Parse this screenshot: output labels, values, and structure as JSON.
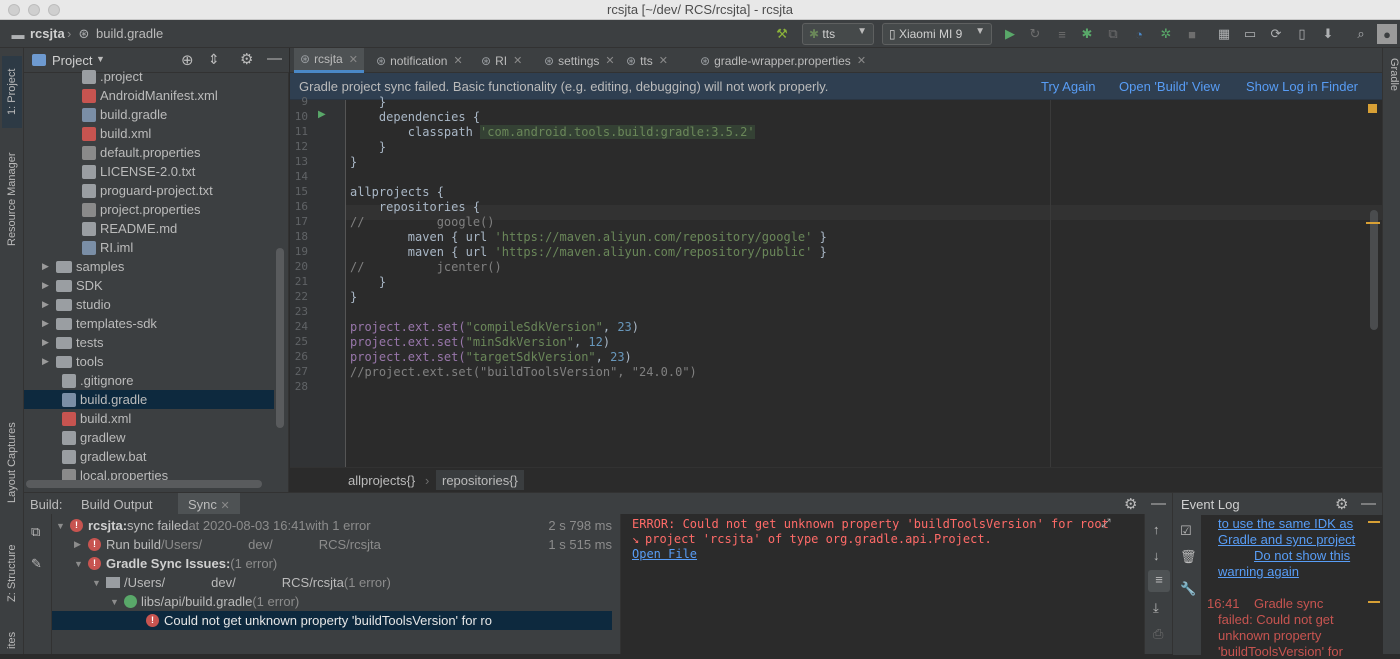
{
  "window": {
    "title": "rcsjta [~/dev/           RCS/rcsjta] - rcsjta"
  },
  "navbar": {
    "project": "rcsjta",
    "file": "build.gradle",
    "run_config": "tts",
    "device": "Xiaomi MI 9"
  },
  "left_strip": {
    "project_tab": "1: Project",
    "resource_manager": "Resource Manager",
    "layout_captures": "Layout Captures",
    "structure": "Z: Structure",
    "favorites": "ites"
  },
  "right_strip": {
    "gradle": "Gradle"
  },
  "project_panel": {
    "title": "Project",
    "items": [
      {
        "label": ".project",
        "kind": "file"
      },
      {
        "label": "AndroidManifest.xml",
        "kind": "xml"
      },
      {
        "label": "build.gradle",
        "kind": "gradle"
      },
      {
        "label": "build.xml",
        "kind": "xml"
      },
      {
        "label": "default.properties",
        "kind": "props"
      },
      {
        "label": "LICENSE-2.0.txt",
        "kind": "file"
      },
      {
        "label": "proguard-project.txt",
        "kind": "file"
      },
      {
        "label": "project.properties",
        "kind": "props"
      },
      {
        "label": "README.md",
        "kind": "file"
      },
      {
        "label": "RI.iml",
        "kind": "iml"
      },
      {
        "label": "samples",
        "kind": "folder"
      },
      {
        "label": "SDK",
        "kind": "folder"
      },
      {
        "label": "studio",
        "kind": "folder"
      },
      {
        "label": "templates-sdk",
        "kind": "folder"
      },
      {
        "label": "tests",
        "kind": "folder"
      },
      {
        "label": "tools",
        "kind": "folder"
      },
      {
        "label": ".gitignore",
        "kind": "file"
      },
      {
        "label": "build.gradle",
        "kind": "gradle"
      },
      {
        "label": "build.xml",
        "kind": "xml"
      },
      {
        "label": "gradlew",
        "kind": "file"
      },
      {
        "label": "gradlew.bat",
        "kind": "file"
      },
      {
        "label": "local.properties",
        "kind": "props"
      }
    ]
  },
  "editor_tabs": [
    {
      "label": "rcsjta"
    },
    {
      "label": "notification"
    },
    {
      "label": "RI"
    },
    {
      "label": "settings"
    },
    {
      "label": "tts"
    },
    {
      "label": "gradle-wrapper.properties"
    }
  ],
  "banner": {
    "message": "Gradle project sync failed. Basic functionality (e.g. editing, debugging) will not work properly.",
    "try_again": "Try Again",
    "open_build": "Open 'Build' View",
    "show_log": "Show Log in Finder"
  },
  "code": {
    "line_numbers": [
      "9",
      "10",
      "11",
      "12",
      "13",
      "14",
      "15",
      "16",
      "17",
      "18",
      "19",
      "20",
      "21",
      "22",
      "23",
      "24",
      "25",
      "26",
      "27",
      "28"
    ],
    "lines": [
      "    }",
      "    dependencies {",
      "        classpath ",
      "    }",
      "}",
      "",
      "allprojects {",
      "    repositories {",
      "//          google()",
      "        maven { url ",
      "        maven { url ",
      "//          jcenter()",
      "    }",
      "}",
      "",
      "project.ext.set(",
      "project.ext.set(",
      "project.ext.set(",
      "//project.ext.set(\"buildToolsVersion\", \"24.0.0\")",
      ""
    ],
    "classpath_value": "'com.android.tools.build:gradle:3.5.2'",
    "maven_google": "'https://maven.aliyun.com/repository/google'",
    "maven_public": "'https://maven.aliyun.com/repository/public'",
    "compile_key": "\"compileSdkVersion\"",
    "compile_val": "23",
    "min_key": "\"minSdkVersion\"",
    "min_val": "12",
    "target_key": "\"targetSdkVersion\"",
    "target_val": "23"
  },
  "editor_breadcrumbs": [
    "allprojects{}",
    "repositories{}"
  ],
  "build_panel": {
    "label": "Build:",
    "tab_output": "Build Output",
    "tab_sync": "Sync",
    "rows": {
      "root_name": "rcsjta:",
      "root_status": " sync failed",
      "root_time": " at 2020-08-03 16:41",
      "root_err": "  with 1 error",
      "root_duration": "2 s 798 ms",
      "run_build": "Run build",
      "run_build_path_a": " /Users/",
      "run_build_path_b": "dev/",
      "run_build_path_c": "RCS/rcsjta",
      "run_build_duration": "1 s 515 ms",
      "issues": "Gradle Sync Issues:",
      "issues_count": " (1 error)",
      "users_path_a": "/Users/",
      "users_path_b": "dev/",
      "users_path_c": "RCS/rcsjta",
      "users_count": " (1 error)",
      "lib_file": "libs/api/build.gradle",
      "lib_count": " (1 error)",
      "error_msg": "Could not get unknown property 'buildToolsVersion' for ro"
    },
    "output": {
      "line1": "ERROR: Could not get unknown property 'buildToolsVersion' for root",
      "line2": "project 'rcsjta' of type org.gradle.api.Project.",
      "link": "Open File"
    }
  },
  "event_log": {
    "title": "Event Log",
    "link1": "to use the same IDK as",
    "link2": "Gradle and sync project",
    "link3": "Do not show this",
    "link4": "warning again",
    "time": "16:41",
    "msg1": "Gradle sync",
    "msg2": "failed: Could not get",
    "msg3": "unknown property",
    "msg4": "'buildToolsVersion' for"
  },
  "colors": {
    "accent": "#4a88c7",
    "error": "#c75450",
    "link": "#589df6",
    "string": "#6a8759",
    "number": "#6897bb"
  }
}
